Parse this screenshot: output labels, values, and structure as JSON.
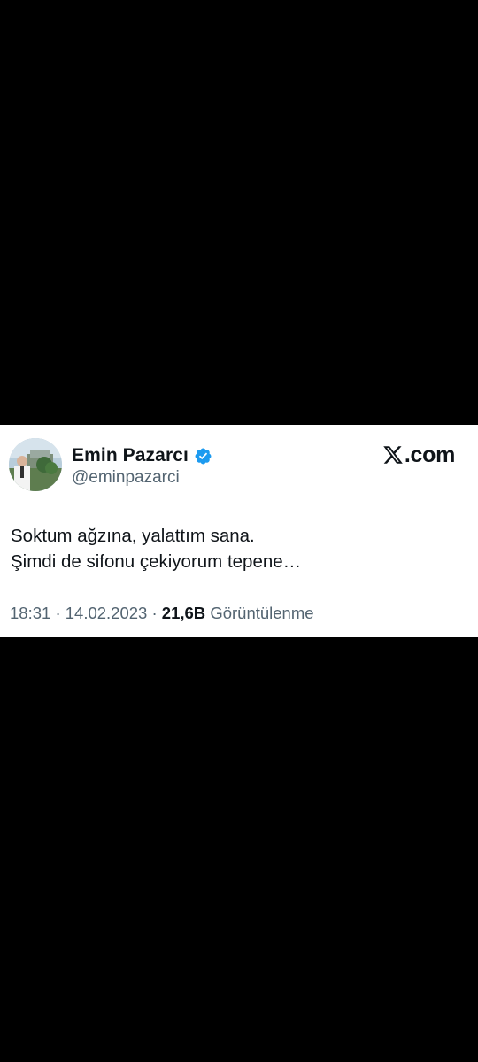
{
  "tweet": {
    "display_name": "Emin Pazarcı",
    "handle": "@eminpazarci",
    "verified_icon": "verified-badge-icon",
    "brand_text": ".com",
    "brand_icon": "x-logo-icon",
    "text_lines": [
      "Soktum ağzına, yalattım sana.",
      "Şimdi de sifonu çekiyorum tepene…"
    ],
    "time": "18:31",
    "date": "14.02.2023",
    "separator": "·",
    "views_count": "21,6B",
    "views_label": "Görüntülenme"
  },
  "colors": {
    "background": "#000000",
    "card": "#ffffff",
    "text_primary": "#0f1419",
    "text_secondary": "#536471",
    "verified_blue": "#1d9bf0"
  }
}
